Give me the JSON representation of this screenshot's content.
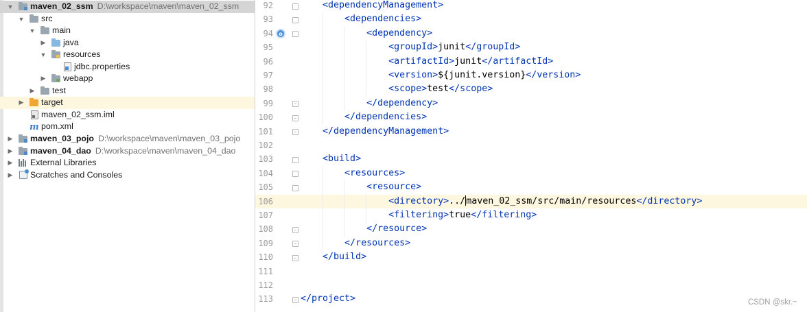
{
  "tree": {
    "items": [
      {
        "label": "maven_02_ssm",
        "path": "D:\\workspace\\maven\\maven_02_ssm"
      },
      {
        "label": "src"
      },
      {
        "label": "main"
      },
      {
        "label": "java"
      },
      {
        "label": "resources"
      },
      {
        "label": "jdbc.properties"
      },
      {
        "label": "webapp"
      },
      {
        "label": "test"
      },
      {
        "label": "target"
      },
      {
        "label": "maven_02_ssm.iml"
      },
      {
        "label": "pom.xml"
      },
      {
        "label": "maven_03_pojo",
        "path": "D:\\workspace\\maven\\maven_03_pojo"
      },
      {
        "label": "maven_04_dao",
        "path": "D:\\workspace\\maven\\maven_04_dao"
      },
      {
        "label": "External Libraries"
      },
      {
        "label": "Scratches and Consoles"
      }
    ]
  },
  "editor": {
    "lines": [
      {
        "num": "92",
        "indent": "    ",
        "tag": "<dependencyManagement>"
      },
      {
        "num": "93",
        "indent": "        ",
        "tag": "<dependencies>"
      },
      {
        "num": "94",
        "indent": "            ",
        "tag": "<dependency>"
      },
      {
        "num": "95",
        "indent": "                ",
        "open": "<groupId>",
        "text": "junit",
        "close": "</groupId>"
      },
      {
        "num": "96",
        "indent": "                ",
        "open": "<artifactId>",
        "text": "junit",
        "close": "</artifactId>"
      },
      {
        "num": "97",
        "indent": "                ",
        "open": "<version>",
        "text": "${junit.version}",
        "close": "</version>"
      },
      {
        "num": "98",
        "indent": "                ",
        "open": "<scope>",
        "text": "test",
        "close": "</scope>"
      },
      {
        "num": "99",
        "indent": "            ",
        "tag": "</dependency>"
      },
      {
        "num": "100",
        "indent": "        ",
        "tag": "</dependencies>"
      },
      {
        "num": "101",
        "indent": "    ",
        "tag": "</dependencyManagement>"
      },
      {
        "num": "102",
        "indent": "",
        "tag": ""
      },
      {
        "num": "103",
        "indent": "    ",
        "tag": "<build>"
      },
      {
        "num": "104",
        "indent": "        ",
        "tag": "<resources>"
      },
      {
        "num": "105",
        "indent": "            ",
        "tag": "<resource>"
      },
      {
        "num": "106",
        "indent": "                ",
        "open": "<directory>",
        "text_before_caret": "../",
        "text": "maven_02_ssm/src/main/resources",
        "close": "</directory>"
      },
      {
        "num": "107",
        "indent": "                ",
        "open": "<filtering>",
        "text": "true",
        "close": "</filtering>"
      },
      {
        "num": "108",
        "indent": "            ",
        "tag": "</resource>"
      },
      {
        "num": "109",
        "indent": "        ",
        "tag": "</resources>"
      },
      {
        "num": "110",
        "indent": "    ",
        "tag": "</build>"
      },
      {
        "num": "111",
        "indent": "",
        "tag": ""
      },
      {
        "num": "112",
        "indent": "",
        "tag": ""
      },
      {
        "num": "113",
        "indent": "",
        "tag": "</project>"
      }
    ]
  },
  "watermark": "CSDN @skr.~",
  "colors": {
    "tag": "#0033b3",
    "text": "#000000",
    "current_line": "#fdf7e0",
    "selection": "#d5d5d5"
  },
  "icons": [
    "module-folder-icon",
    "folder-icon",
    "java-source-folder-icon",
    "resources-folder-icon",
    "properties-file-icon",
    "web-folder-icon",
    "excluded-folder-icon",
    "iml-file-icon",
    "maven-pom-icon",
    "library-icon",
    "scratch-icon",
    "override-marker-icon"
  ]
}
